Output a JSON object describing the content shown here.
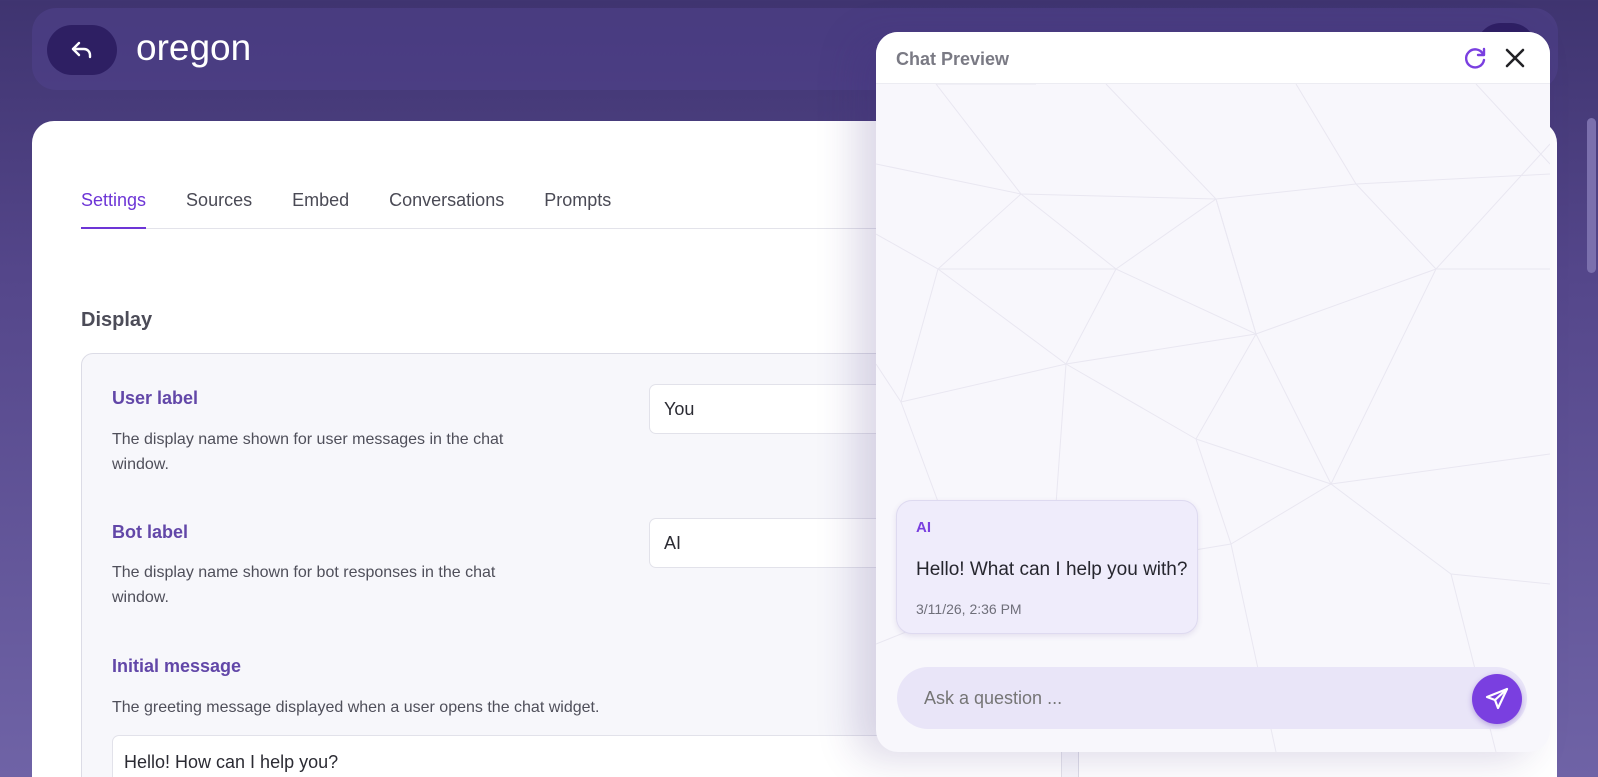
{
  "header": {
    "title": "oregon"
  },
  "tabs": [
    {
      "label": "Settings",
      "active": true
    },
    {
      "label": "Sources",
      "active": false
    },
    {
      "label": "Embed",
      "active": false
    },
    {
      "label": "Conversations",
      "active": false
    },
    {
      "label": "Prompts",
      "active": false
    }
  ],
  "display": {
    "section_title": "Display",
    "user_label": {
      "label": "User label",
      "description": "The display name shown for user messages in the chat window.",
      "value": "You"
    },
    "bot_label": {
      "label": "Bot label",
      "description": "The display name shown for bot responses in the chat window.",
      "value": "AI"
    },
    "initial_message": {
      "label": "Initial message",
      "description": "The greeting message displayed when a user opens the chat widget.",
      "value": "Hello! How can I help you?"
    }
  },
  "chat_preview": {
    "title": "Chat Preview",
    "message": {
      "sender": "AI",
      "text": "Hello! What can I help you with?",
      "timestamp": "3/11/26, 2:36 PM"
    },
    "input_placeholder": "Ask a question ..."
  },
  "colors": {
    "accent": "#7a3fe0",
    "label": "#6247a8",
    "header_bg": "#3f3470"
  },
  "icons": {
    "back": "undo-arrow-icon",
    "refresh": "refresh-icon",
    "close": "close-icon",
    "send": "send-icon"
  }
}
